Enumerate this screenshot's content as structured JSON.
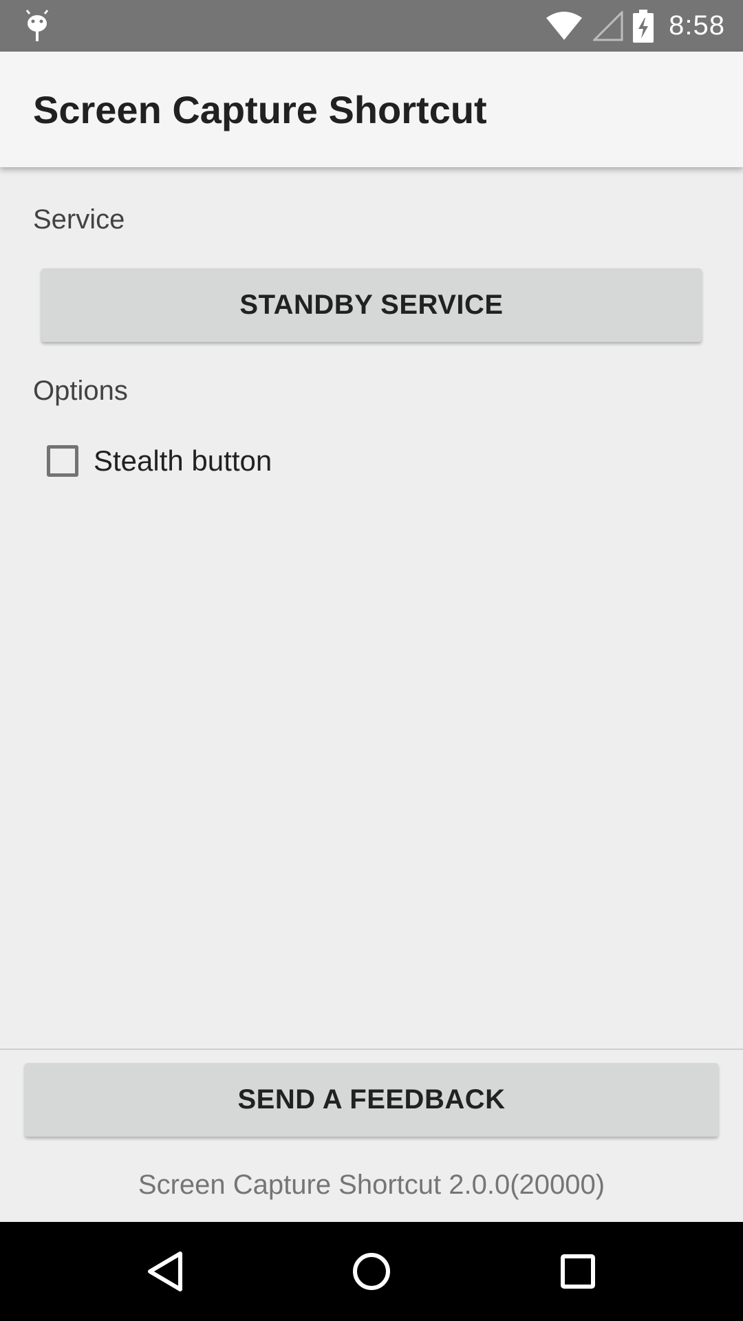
{
  "status_bar": {
    "time": "8:58",
    "icons": [
      "android-debug-icon",
      "wifi-icon",
      "signal-icon",
      "battery-charging-icon"
    ]
  },
  "app_bar": {
    "title": "Screen Capture Shortcut"
  },
  "service_section": {
    "label": "Service",
    "button_label": "STANDBY SERVICE"
  },
  "options_section": {
    "label": "Options",
    "stealth_checkbox": {
      "label": "Stealth button",
      "checked": false
    }
  },
  "footer": {
    "feedback_button_label": "SEND A FEEDBACK",
    "version_text": "Screen Capture Shortcut 2.0.0(20000)"
  },
  "navigation_bar": {
    "icons": [
      "back-icon",
      "home-icon",
      "recents-icon"
    ]
  },
  "colors": {
    "status_bar": "#757575",
    "app_bar": "#f5f5f5",
    "background": "#eeeeee",
    "button": "#d6d7d7",
    "nav_bar": "#000000"
  }
}
